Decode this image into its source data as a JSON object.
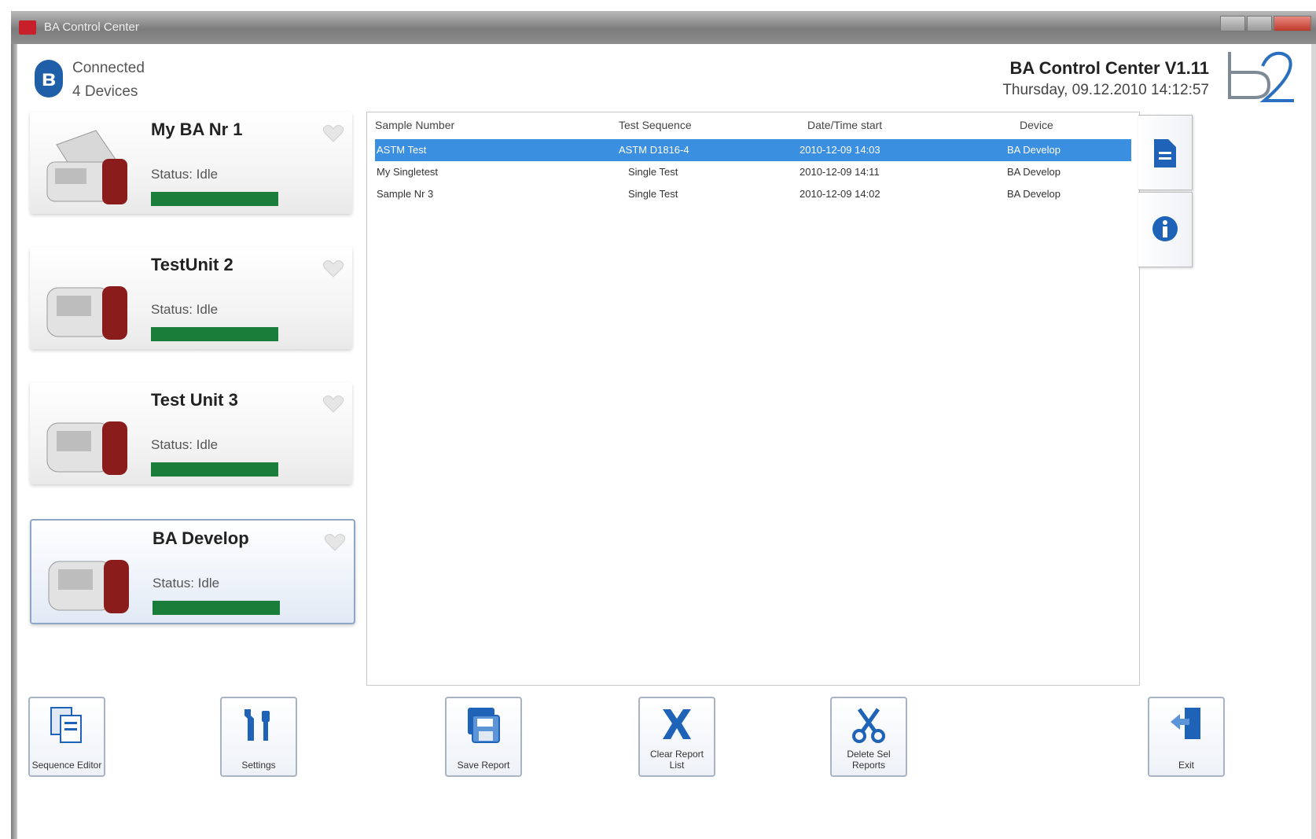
{
  "window": {
    "title": "BA Control Center"
  },
  "header": {
    "connection_status": "Connected",
    "device_count": "4 Devices",
    "app_title": "BA Control Center V1.11",
    "datetime": "Thursday, 09.12.2010 14:12:57",
    "logo_text": "b2"
  },
  "devices": [
    {
      "name": "My BA Nr 1",
      "status": "Status: Idle",
      "progress": 1.0,
      "selected": false
    },
    {
      "name": "TestUnit 2",
      "status": "Status: Idle",
      "progress": 1.0,
      "selected": false
    },
    {
      "name": "Test Unit 3",
      "status": "Status: Idle",
      "progress": 1.0,
      "selected": false
    },
    {
      "name": "BA Develop",
      "status": "Status: Idle",
      "progress": 1.0,
      "selected": true
    }
  ],
  "report_table": {
    "columns": [
      "Sample Number",
      "Test Sequence",
      "Date/Time start",
      "Device"
    ],
    "rows": [
      {
        "sample": "ASTM Test",
        "sequence": "ASTM D1816-4",
        "start": "2010-12-09 14:03",
        "device": "BA Develop",
        "selected": true
      },
      {
        "sample": "My Singletest",
        "sequence": "Single Test",
        "start": "2010-12-09 14:11",
        "device": "BA Develop",
        "selected": false
      },
      {
        "sample": "Sample Nr 3",
        "sequence": "Single Test",
        "start": "2010-12-09 14:02",
        "device": "BA Develop",
        "selected": false
      }
    ]
  },
  "side_buttons": {
    "report_icon": "report-icon",
    "info_icon": "info-icon"
  },
  "toolbar": {
    "sequence_editor": "Sequence Editor",
    "settings": "Settings",
    "save_report": "Save Report",
    "clear_report_list": "Clear Report List",
    "delete_sel_reports": "Delete Sel Reports",
    "exit": "Exit"
  },
  "colors": {
    "selection": "#3b8fe0",
    "status_bar": "#1a7d3a",
    "bluetooth": "#1f5fa8",
    "toolbar_icon": "#1e63b8"
  }
}
